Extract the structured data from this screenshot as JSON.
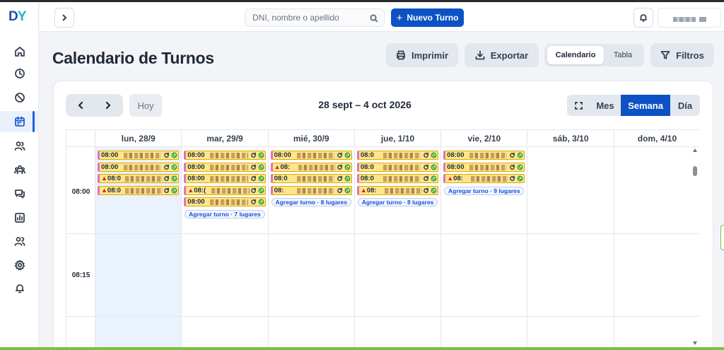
{
  "app": {
    "logo_main": "D",
    "logo_accent": "Y"
  },
  "sidebar": {
    "items": [
      {
        "icon": "home-icon"
      },
      {
        "icon": "clock-icon"
      },
      {
        "icon": "ban-icon"
      },
      {
        "icon": "calendar-icon",
        "active": true
      },
      {
        "icon": "users-icon"
      },
      {
        "icon": "team-icon"
      },
      {
        "icon": "chat-icon"
      },
      {
        "icon": "chart-icon"
      },
      {
        "icon": "user-group-icon"
      },
      {
        "icon": "gear-icon"
      },
      {
        "icon": "bell-icon"
      }
    ]
  },
  "header": {
    "search_placeholder": "DNI, nombre o apellido",
    "new_button_label": "Nuevo Turno"
  },
  "page": {
    "title": "Calendario de Turnos",
    "print_label": "Imprimir",
    "export_label": "Exportar",
    "view_calendar_label": "Calendario",
    "view_table_label": "Tabla",
    "filters_label": "Filtros"
  },
  "calendar": {
    "today_label": "Hoy",
    "range_title": "28 sept – 4 oct 2026",
    "view_month_label": "Mes",
    "view_week_label": "Semana",
    "view_day_label": "Día",
    "selected_view": "Semana",
    "days": [
      "lun, 28/9",
      "mar, 29/9",
      "mié, 30/9",
      "jue, 1/10",
      "vie, 2/10",
      "sáb, 3/10",
      "dom, 4/10"
    ],
    "time_slots": [
      "08:00",
      "08:15"
    ],
    "appointments": [
      [
        {
          "time": "08:00",
          "warn": false
        },
        {
          "time": "08:00",
          "warn": false
        },
        {
          "time": "08:0",
          "warn": true
        },
        {
          "time": "08:0",
          "warn": true
        }
      ],
      [
        {
          "time": "08:00",
          "warn": false
        },
        {
          "time": "08:00",
          "warn": false
        },
        {
          "time": "08:00",
          "warn": false
        },
        {
          "time": "08:(",
          "warn": true
        },
        {
          "time": "08:00",
          "warn": false
        }
      ],
      [
        {
          "time": "08:00",
          "warn": false
        },
        {
          "time": "08:",
          "warn": true
        },
        {
          "time": "08:0",
          "warn": false
        },
        {
          "time": "08:",
          "warn": false
        }
      ],
      [
        {
          "time": "08:0",
          "warn": false
        },
        {
          "time": "08:0",
          "warn": false
        },
        {
          "time": "08:0",
          "warn": false
        },
        {
          "time": "08:",
          "warn": true
        }
      ],
      [
        {
          "time": "08:00",
          "warn": false
        },
        {
          "time": "08:00",
          "warn": false
        },
        {
          "time": "08:",
          "warn": true
        }
      ],
      [],
      []
    ],
    "add_slots": [
      null,
      "Agregar turno · 7 lugares",
      "Agregar turno · 8 lugares",
      "Agregar turno · 8 lugares",
      "Agregar turno · 9 lugares",
      null,
      null
    ]
  },
  "colors": {
    "primary": "#0d52c4",
    "appointment_bg": "#fde68a",
    "appointment_tag": "#e46fc0",
    "today_bg": "#eaf2fd"
  }
}
